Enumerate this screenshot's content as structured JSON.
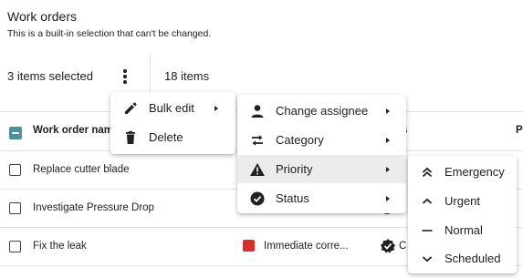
{
  "header": {
    "title": "Work orders",
    "subtitle": "This is a built-in selection that can't be changed."
  },
  "toolbar": {
    "selected_text": "3 items selected",
    "item_count": "18 items",
    "more_icon": "more-vert-icon"
  },
  "table": {
    "columns": [
      "Work order nam",
      "s",
      "P"
    ],
    "rows": [
      {
        "name": "Replace cutter blade",
        "selected": false
      },
      {
        "name": "Investigate Pressure Drop",
        "selected": false
      },
      {
        "name": "Fix the leak",
        "selected": false,
        "category": "Immediate corre...",
        "category_color": "#d32f2f",
        "status_text": "C"
      }
    ],
    "header_checkbox": "indeterminate"
  },
  "menu_primary": {
    "items": [
      {
        "label": "Bulk edit",
        "icon": "pencil-icon",
        "submenu": true
      },
      {
        "label": "Delete",
        "icon": "trash-icon",
        "submenu": false
      }
    ]
  },
  "menu_bulk_edit": {
    "items": [
      {
        "label": "Change assignee",
        "icon": "person-icon",
        "submenu": true
      },
      {
        "label": "Category",
        "icon": "swap-arrows-icon",
        "submenu": true
      },
      {
        "label": "Priority",
        "icon": "warning-icon",
        "submenu": true,
        "active": true
      },
      {
        "label": "Status",
        "icon": "check-circle-icon",
        "submenu": true
      }
    ]
  },
  "menu_priority": {
    "items": [
      {
        "label": "Emergency",
        "icon": "double-chevron-up-icon"
      },
      {
        "label": "Urgent",
        "icon": "chevron-up-icon"
      },
      {
        "label": "Normal",
        "icon": "dash-icon"
      },
      {
        "label": "Scheduled",
        "icon": "chevron-down-icon"
      }
    ]
  },
  "colors": {
    "accent": "#4e8f9e",
    "danger": "#d32f2f",
    "hover": "#ececec",
    "divider": "#e0e0e0"
  }
}
